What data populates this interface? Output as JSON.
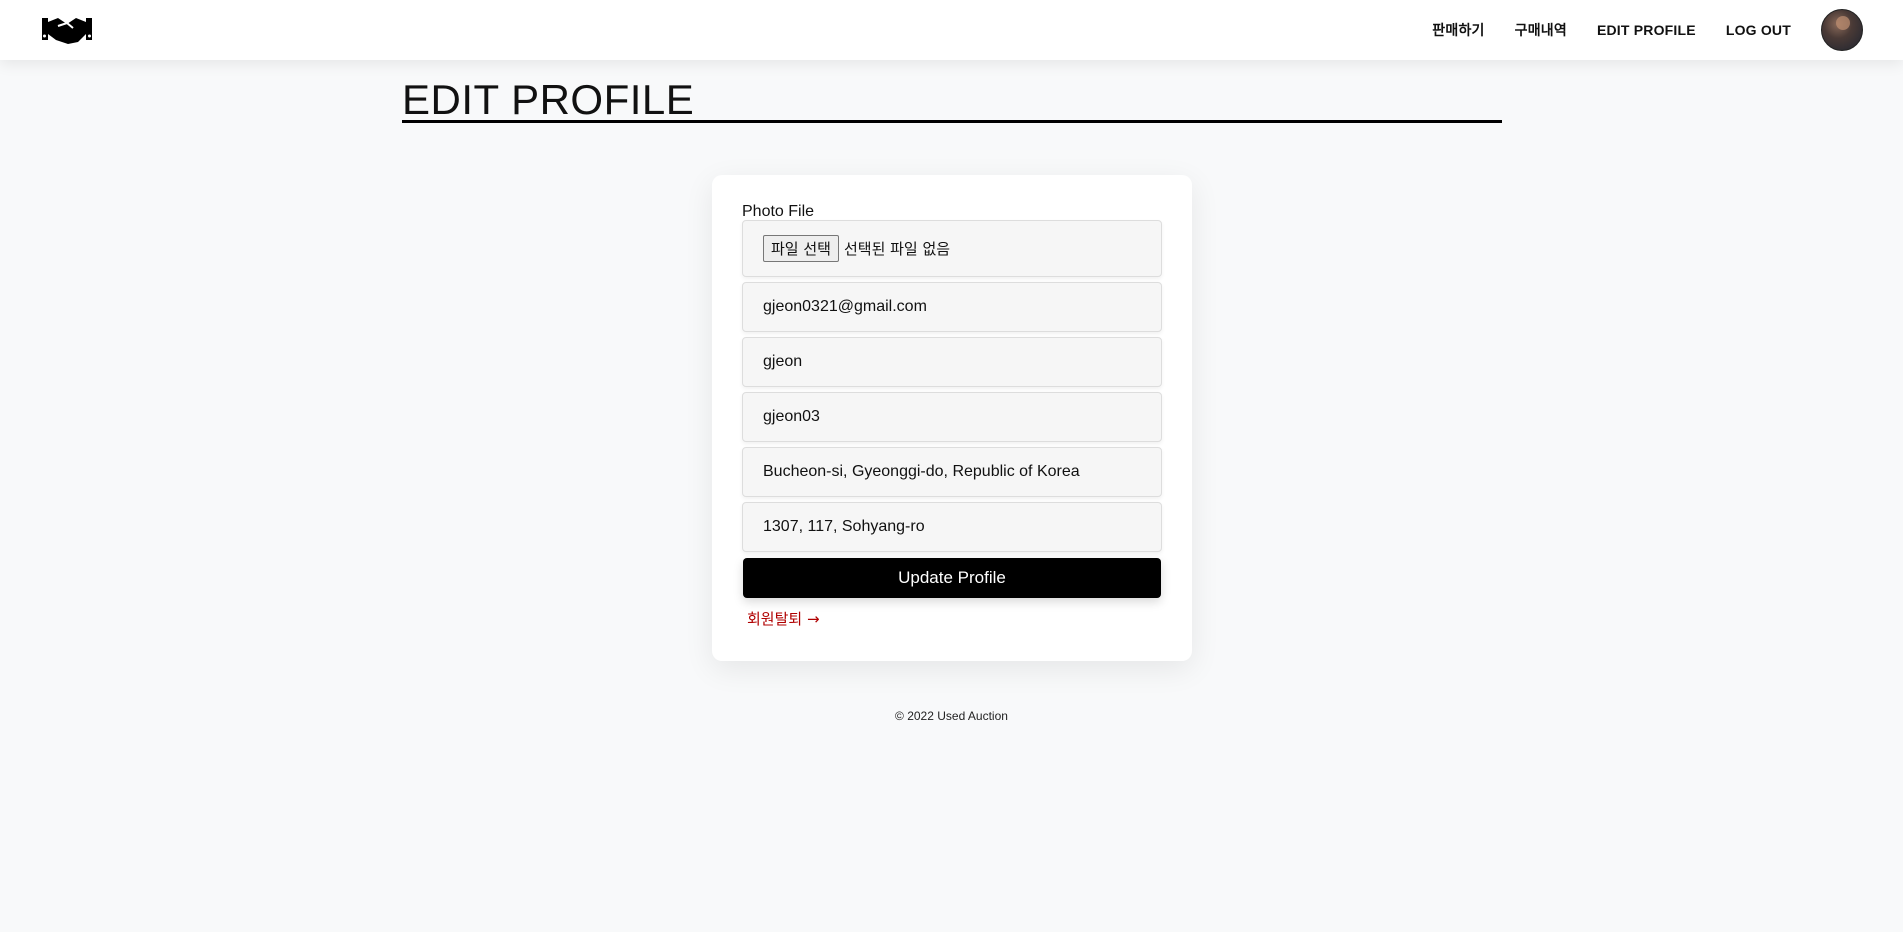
{
  "nav": {
    "links": [
      "판매하기",
      "구매내역",
      "EDIT PROFILE",
      "LOG OUT"
    ]
  },
  "page": {
    "title": "EDIT PROFILE"
  },
  "form": {
    "photo_label": "Photo File",
    "file_button": "파일 선택",
    "file_status": "선택된 파일 없음",
    "email": "gjeon0321@gmail.com",
    "name": "gjeon",
    "username": "gjeon03",
    "address": "Bucheon-si, Gyeonggi-do, Republic of Korea",
    "address_detail": "1307, 117, Sohyang-ro",
    "submit_label": "Update Profile",
    "withdraw_label": "회원탈퇴 →"
  },
  "footer": {
    "text": "© 2022 Used Auction"
  },
  "colors": {
    "accent": "#000000",
    "danger": "#b00000",
    "background": "#f8f9fa"
  },
  "icons": {
    "logo": "handshake-logo-icon"
  }
}
